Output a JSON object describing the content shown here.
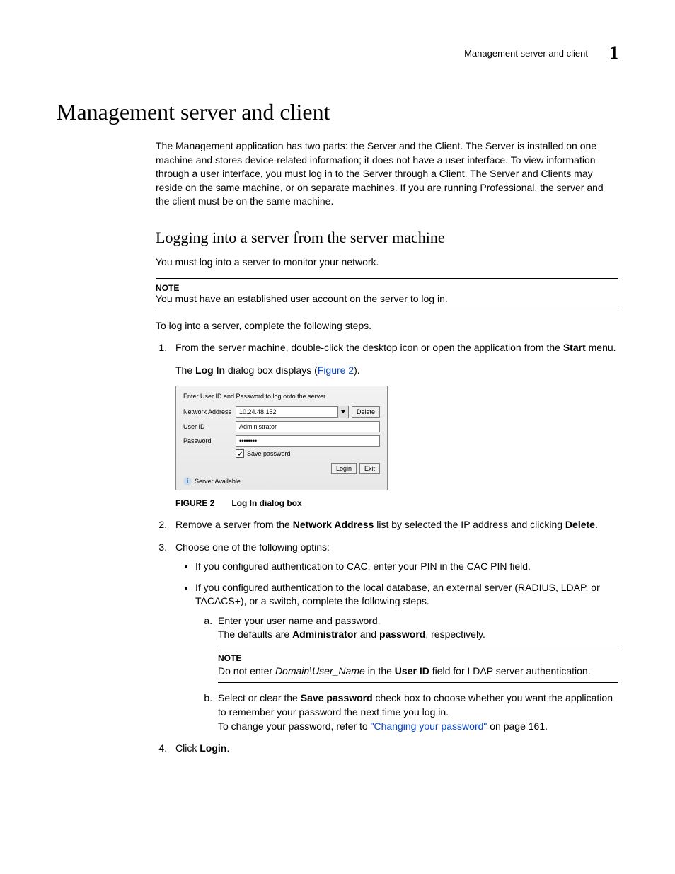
{
  "header": {
    "section": "Management server and client",
    "chapter_number": "1"
  },
  "h1": "Management server and client",
  "intro_paragraph": "The Management application has two parts: the Server and the Client. The Server is installed on one machine and stores device-related information; it does not have a user interface. To view information through a user interface, you must log in to the Server through a Client. The Server and Clients may reside on the same machine, or on separate machines. If you are running Professional, the server and the client must be on the same machine.",
  "h2": "Logging into a server from the server machine",
  "p_login_intro": "You must log into a server to monitor your network.",
  "note1_label": "NOTE",
  "note1_text": "You must have an established user account on the server to log in.",
  "p_steps_intro": "To log into a server, complete the following steps.",
  "step1_a": "From the server machine, double-click the desktop icon or open the application from the ",
  "step1_bold": "Start",
  "step1_b": " menu.",
  "step1_line2_a": "The ",
  "step1_line2_bold": "Log In",
  "step1_line2_b": " dialog box displays (",
  "step1_fig_link": "Figure 2",
  "step1_line2_c": ").",
  "dialog": {
    "prompt": "Enter User ID and Password to log onto the server",
    "network_label": "Network Address",
    "network_value": "10.24.48.152",
    "delete_btn": "Delete",
    "user_label": "User ID",
    "user_value": "Administrator",
    "password_label": "Password",
    "password_value": "••••••••",
    "save_password": "Save password",
    "login_btn": "Login",
    "exit_btn": "Exit",
    "status": "Server Available"
  },
  "fig_caption_label": "FIGURE 2",
  "fig_caption_title": "Log In dialog box",
  "step2_a": "Remove a server from the ",
  "step2_bold1": "Network Address",
  "step2_b": " list by selected the IP address and clicking ",
  "step2_bold2": "Delete",
  "step2_c": ".",
  "step3": "Choose one of the following optins:",
  "b1": "If you configured authentication to CAC, enter your PIN in the CAC PIN field.",
  "b2": "If you configured authentication to the local database, an external server (RADIUS, LDAP, or TACACS+), or a switch, complete the following steps.",
  "sa_line1": "Enter your user name and password.",
  "sa_line2_a": "The defaults are ",
  "sa_line2_bold1": "Administrator",
  "sa_line2_b": " and ",
  "sa_line2_bold2": "password",
  "sa_line2_c": ", respectively.",
  "note2_label": "NOTE",
  "note2_a": "Do not enter ",
  "note2_italic": "Domain\\User_Name",
  "note2_b": " in the ",
  "note2_bold": "User ID",
  "note2_c": " field for LDAP server authentication.",
  "sb_line1_a": "Select or clear the ",
  "sb_line1_bold": "Save password",
  "sb_line1_b": " check box to choose whether you want the application to remember your password the next time you log in.",
  "sb_line2_a": "To change your password, refer to ",
  "sb_line2_link": "\"Changing your password\"",
  "sb_line2_b": " on page 161.",
  "step4_a": "Click ",
  "step4_bold": "Login",
  "step4_b": "."
}
